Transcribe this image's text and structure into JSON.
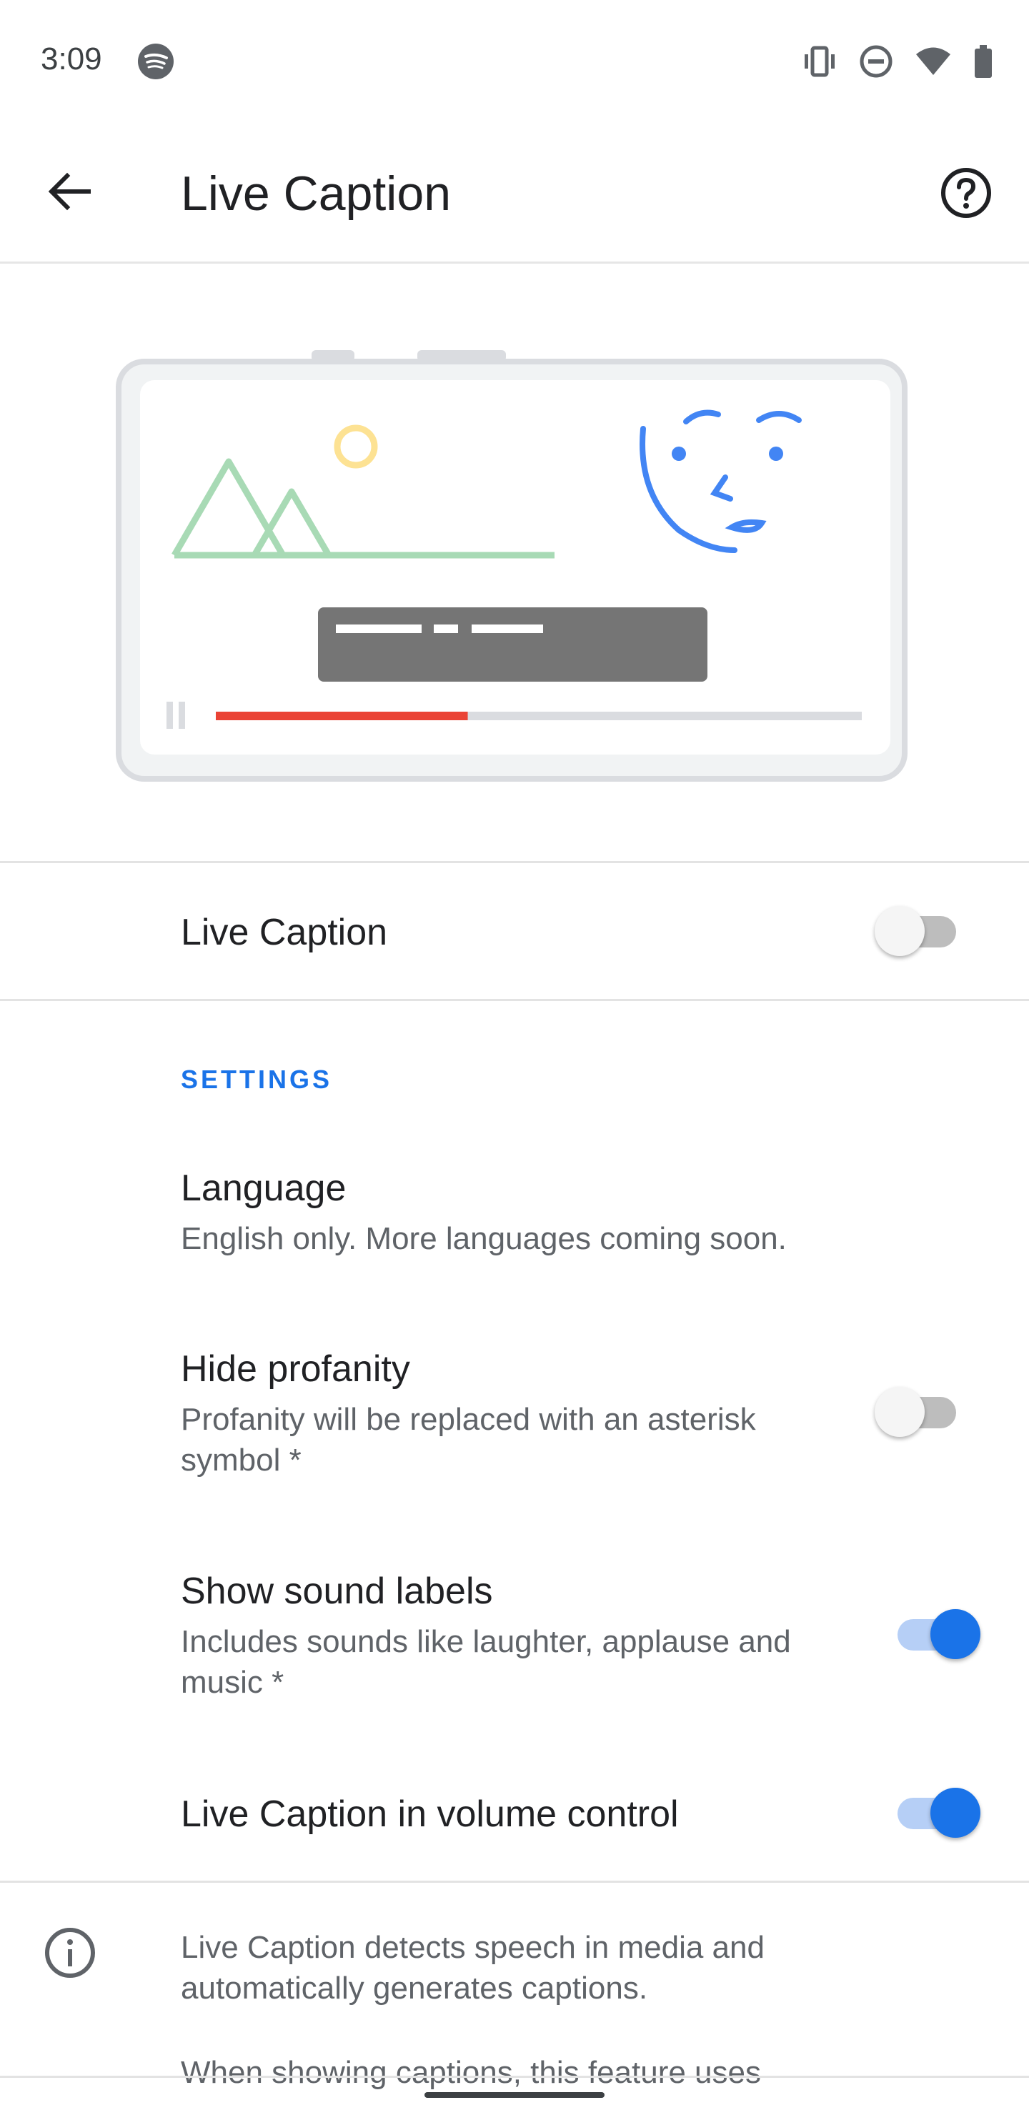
{
  "status_bar": {
    "time": "3:09",
    "icons": [
      "spotify-icon",
      "vibrate-icon",
      "do-not-disturb-icon",
      "wifi-icon",
      "battery-icon"
    ]
  },
  "app_bar": {
    "title": "Live Caption",
    "back_icon": "arrow-back-icon",
    "help_icon": "help-circle-icon"
  },
  "illustration": {
    "name": "live-caption-illustration",
    "progress_fraction": 0.39,
    "colors": {
      "mountains": "#a8dab5",
      "sun": "#fde293",
      "face": "#4285f4",
      "caption_box": "#757575",
      "progress": "#ea4335",
      "track": "#dadce0"
    }
  },
  "main_toggle": {
    "label": "Live Caption",
    "enabled": false
  },
  "settings": {
    "header": "SETTINGS",
    "items": [
      {
        "title": "Language",
        "subtitle": "English only. More languages coming soon."
      },
      {
        "title": "Hide profanity",
        "subtitle": "Profanity will be replaced with an asterisk symbol *",
        "enabled": false
      },
      {
        "title": "Show sound labels",
        "subtitle": "Includes sounds like laughter, applause and music *",
        "enabled": true
      },
      {
        "title": "Live Caption in volume control",
        "enabled": true
      }
    ]
  },
  "footer": {
    "info_icon": "info-icon",
    "text1": "Live Caption detects speech in media and automatically generates captions.",
    "text2": "When showing captions, this feature uses"
  },
  "colors": {
    "accent": "#1a73e8",
    "switch_off_track": "#bdbdbd",
    "switch_on_track": "#b6cff6"
  }
}
